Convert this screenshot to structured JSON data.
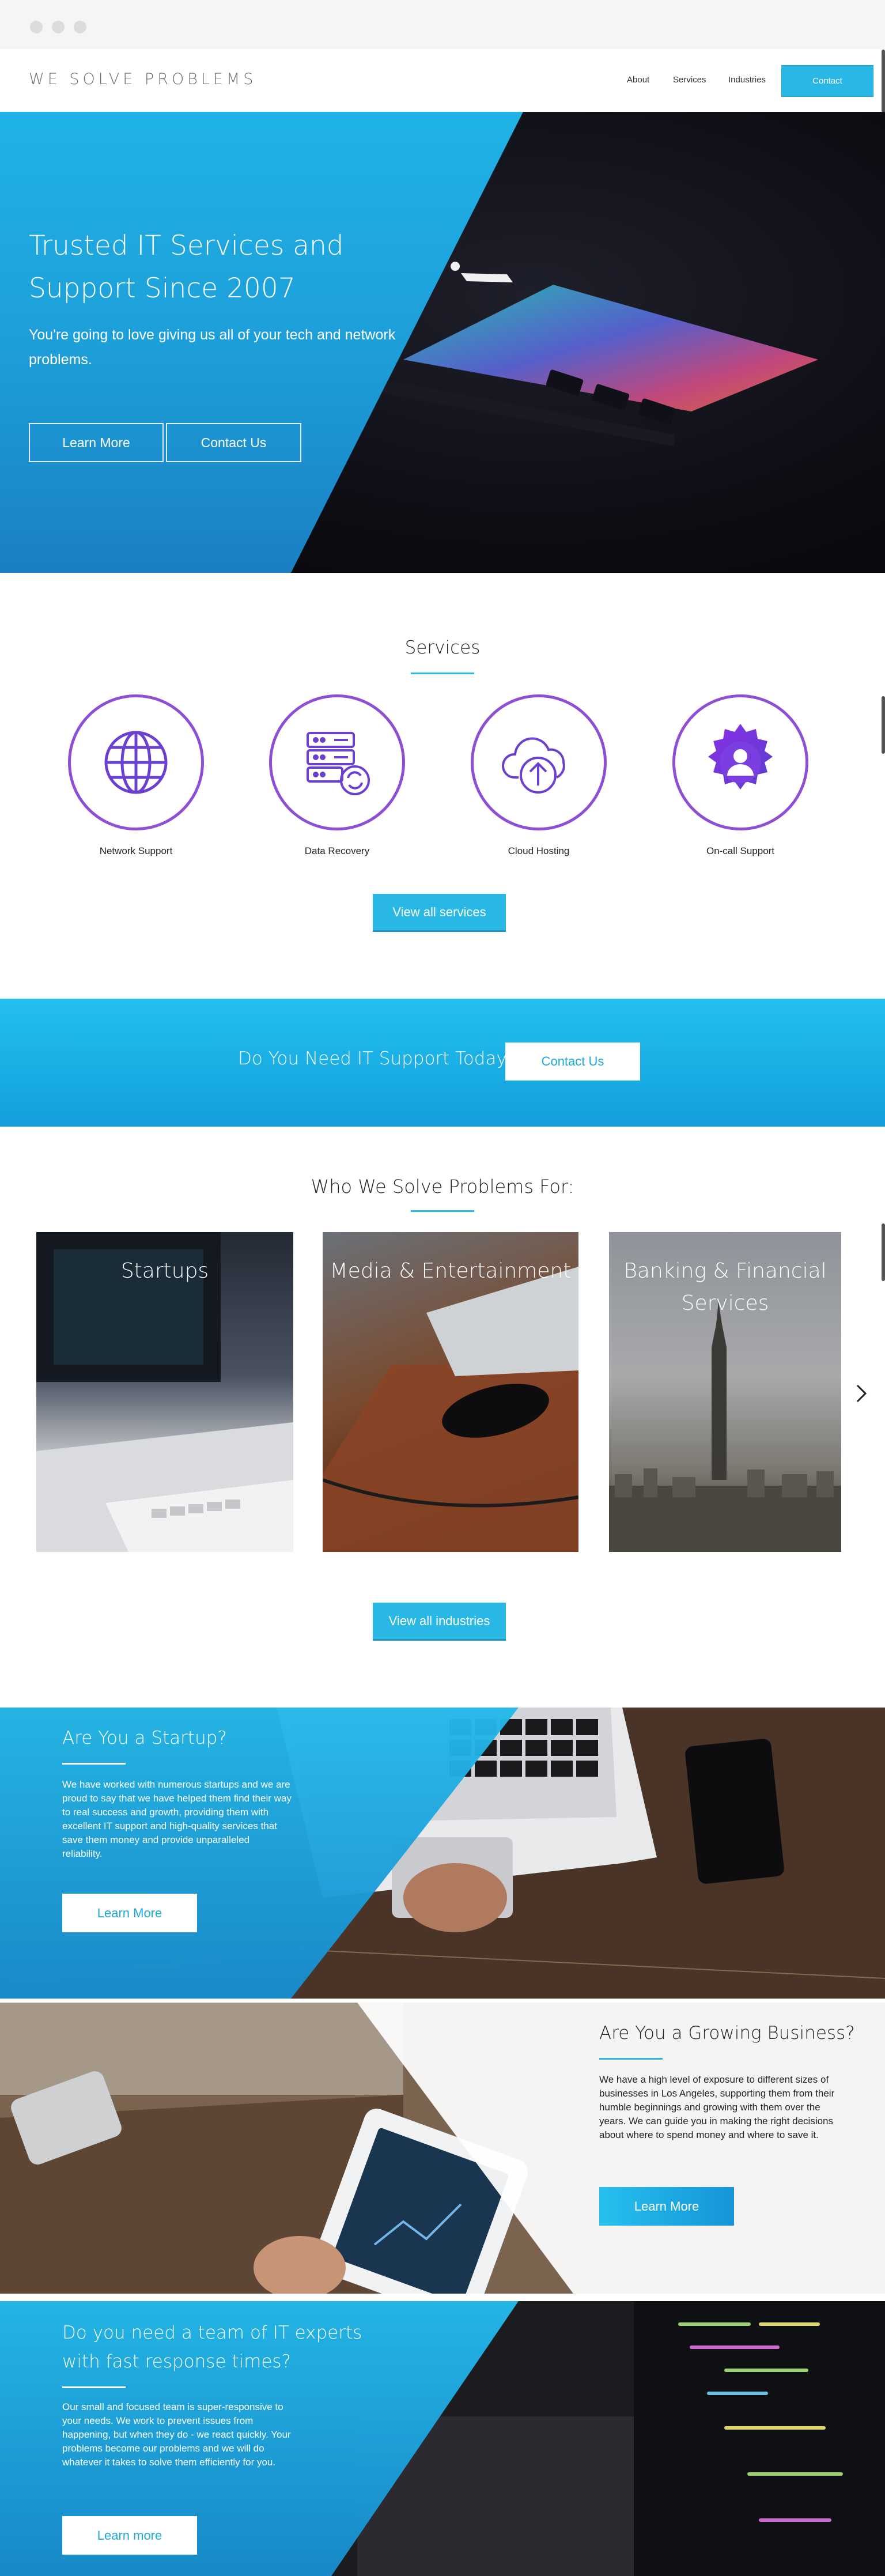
{
  "brand": "WE SOLVE PROBLEMS",
  "nav": {
    "about": "About",
    "services": "Services",
    "industries": "Industries",
    "contact": "Contact"
  },
  "hero": {
    "title": "Trusted IT Services and Support Since 2007",
    "subtitle": "You're going to love giving us all of your tech and network problems.",
    "learn_more": "Learn More",
    "contact_us": "Contact Us"
  },
  "services": {
    "heading": "Services",
    "items": [
      {
        "label": "Network Support",
        "icon": "globe-icon"
      },
      {
        "label": "Data Recovery",
        "icon": "server-recovery-icon"
      },
      {
        "label": "Cloud Hosting",
        "icon": "cloud-upload-icon"
      },
      {
        "label": "On-call Support",
        "icon": "gear-person-icon"
      }
    ],
    "view_all": "View all services"
  },
  "cta_band": {
    "text": "Do You Need IT Support Today?",
    "button": "Contact Us"
  },
  "industries": {
    "heading": "Who We Solve Problems For:",
    "items": [
      {
        "title": "Startups"
      },
      {
        "title": "Media & Entertainment"
      },
      {
        "title": "Banking & Financial Services"
      }
    ],
    "view_all": "View all industries"
  },
  "features": {
    "startup": {
      "title": "Are You a Startup?",
      "text": "We have worked with numerous startups and we are proud to say that we have helped them find their way to real success and growth, providing them with excellent IT support and high-quality services that save them money and provide unparalleled reliability.",
      "button": "Learn More"
    },
    "growing": {
      "title": "Are You a Growing Business?",
      "text": "We have a high level of exposure to different sizes of businesses in Los Angeles, supporting them from their humble beginnings and growing with them over the years. We can guide you in making the right decisions about where to spend money and where to save it.",
      "button": "Learn More"
    },
    "experts": {
      "title": "Do you need a team of IT experts with fast response times?",
      "text": "Our small and focused team is super-responsive to your needs. We work to prevent issues from happening, but when they do - we react quickly. Your problems become our problems and we will do whatever it takes to solve them efficiently for you.",
      "button": "Learn more"
    }
  },
  "colors": {
    "accent": "#29b8e6",
    "icon_purple": "#8e4fd4",
    "dark": "#0d0d14"
  }
}
